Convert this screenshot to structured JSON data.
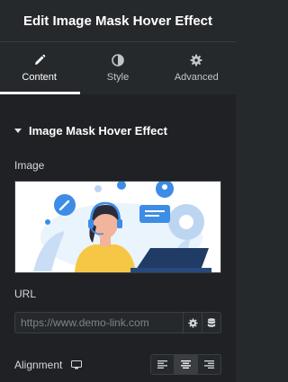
{
  "header": {
    "title": "Edit Image Mask Hover Effect"
  },
  "tabs": [
    {
      "label": "Content",
      "icon": "pencil-icon",
      "active": true
    },
    {
      "label": "Style",
      "icon": "half-circle-icon",
      "active": false
    },
    {
      "label": "Advanced",
      "icon": "gear-icon",
      "active": false
    }
  ],
  "section": {
    "title": "Image Mask Hover Effect"
  },
  "image_field": {
    "label": "Image"
  },
  "url_field": {
    "label": "URL",
    "placeholder": "https://www.demo-link.com"
  },
  "alignment": {
    "label": "Alignment",
    "selected": "center",
    "options": [
      "left",
      "center",
      "right"
    ]
  },
  "colors": {
    "panel": "#26292c",
    "content": "#1f2124",
    "accent": "#ffffff"
  }
}
